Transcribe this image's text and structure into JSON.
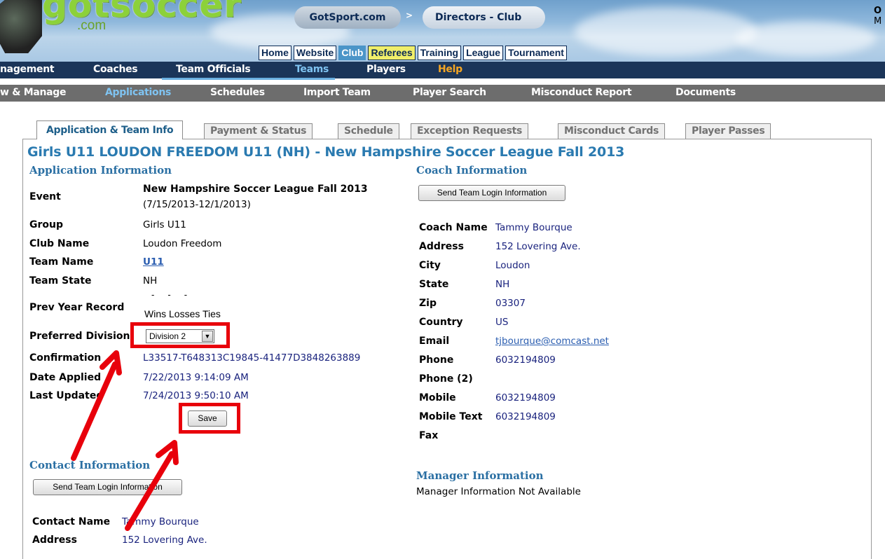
{
  "header": {
    "logo_text": "gotsoccer",
    "logo_domain": ".com",
    "breadcrumb": [
      "GotSport.com",
      "Directors - Club"
    ],
    "breadcrumb_sep": ">",
    "user_initial": "O",
    "user_line2": "M",
    "main_nav": [
      "Home",
      "Website",
      "Club",
      "Referees",
      "Training",
      "League",
      "Tournament"
    ],
    "main_nav_active": "Club"
  },
  "nav1": {
    "items": [
      "nagement",
      "Coaches",
      "Team Officials",
      "Teams",
      "Players",
      "Help"
    ],
    "active": "Teams"
  },
  "nav2": {
    "items": [
      "w & Manage",
      "Applications",
      "Schedules",
      "Import Team",
      "Player Search",
      "Misconduct Report",
      "Documents"
    ],
    "active": "Applications"
  },
  "subtabs": [
    "Application & Team Info",
    "Payment & Status",
    "Schedule",
    "Exception Requests",
    "Misconduct Cards",
    "Player Passes"
  ],
  "page_title": "Girls U11 LOUDON FREEDOM U11 (NH) - New Hampshire Soccer League Fall 2013",
  "application": {
    "section_title": "Application Information",
    "event_label": "Event",
    "event_name": "New Hampshire Soccer League Fall 2013",
    "event_dates": "(7/15/2013-12/1/2013)",
    "group_label": "Group",
    "group": "Girls U11",
    "club_label": "Club Name",
    "club": "Loudon Freedom",
    "team_label": "Team Name",
    "team": "U11",
    "state_label": "Team State",
    "state": "NH",
    "prev_label": "Prev Year Record",
    "prev_dashes": "-     -     -",
    "prev_headers": "Wins Losses Ties",
    "division_label": "Preferred Division",
    "division_value": "Division 2",
    "confirmation_label": "Confirmation",
    "confirmation": "L33517-T648313C19845-41477D3848263889",
    "applied_label": "Date Applied",
    "applied": "7/22/2013 9:14:09 AM",
    "updated_label": "Last Updated",
    "updated": "7/24/2013 9:50:10 AM",
    "save_label": "Save"
  },
  "contact": {
    "section_title": "Contact Information",
    "send_button": "Send Team Login Information",
    "name_label": "Contact Name",
    "name": "Tammy Bourque",
    "address_label": "Address",
    "address": "152 Lovering Ave."
  },
  "coach": {
    "section_title": "Coach Information",
    "send_button": "Send Team Login Information",
    "name_label": "Coach Name",
    "name": "Tammy Bourque",
    "address_label": "Address",
    "address": "152 Lovering Ave.",
    "city_label": "City",
    "city": "Loudon",
    "state_label": "State",
    "state": "NH",
    "zip_label": "Zip",
    "zip": "03307",
    "country_label": "Country",
    "country": "US",
    "email_label": "Email",
    "email": "tjbourque@comcast.net",
    "phone_label": "Phone",
    "phone": "6032194809",
    "phone2_label": "Phone (2)",
    "mobile_label": "Mobile",
    "mobile": "6032194809",
    "mobile_text_label": "Mobile Text",
    "mobile_text": "6032194809",
    "fax_label": "Fax"
  },
  "manager": {
    "section_title": "Manager Information",
    "message": "Manager Information Not Available"
  },
  "colors": {
    "nav_dark": "#1b3559",
    "nav_gray": "#6d6d6d",
    "title_blue": "#2a7ab0",
    "annotation_red": "#e8000b"
  }
}
